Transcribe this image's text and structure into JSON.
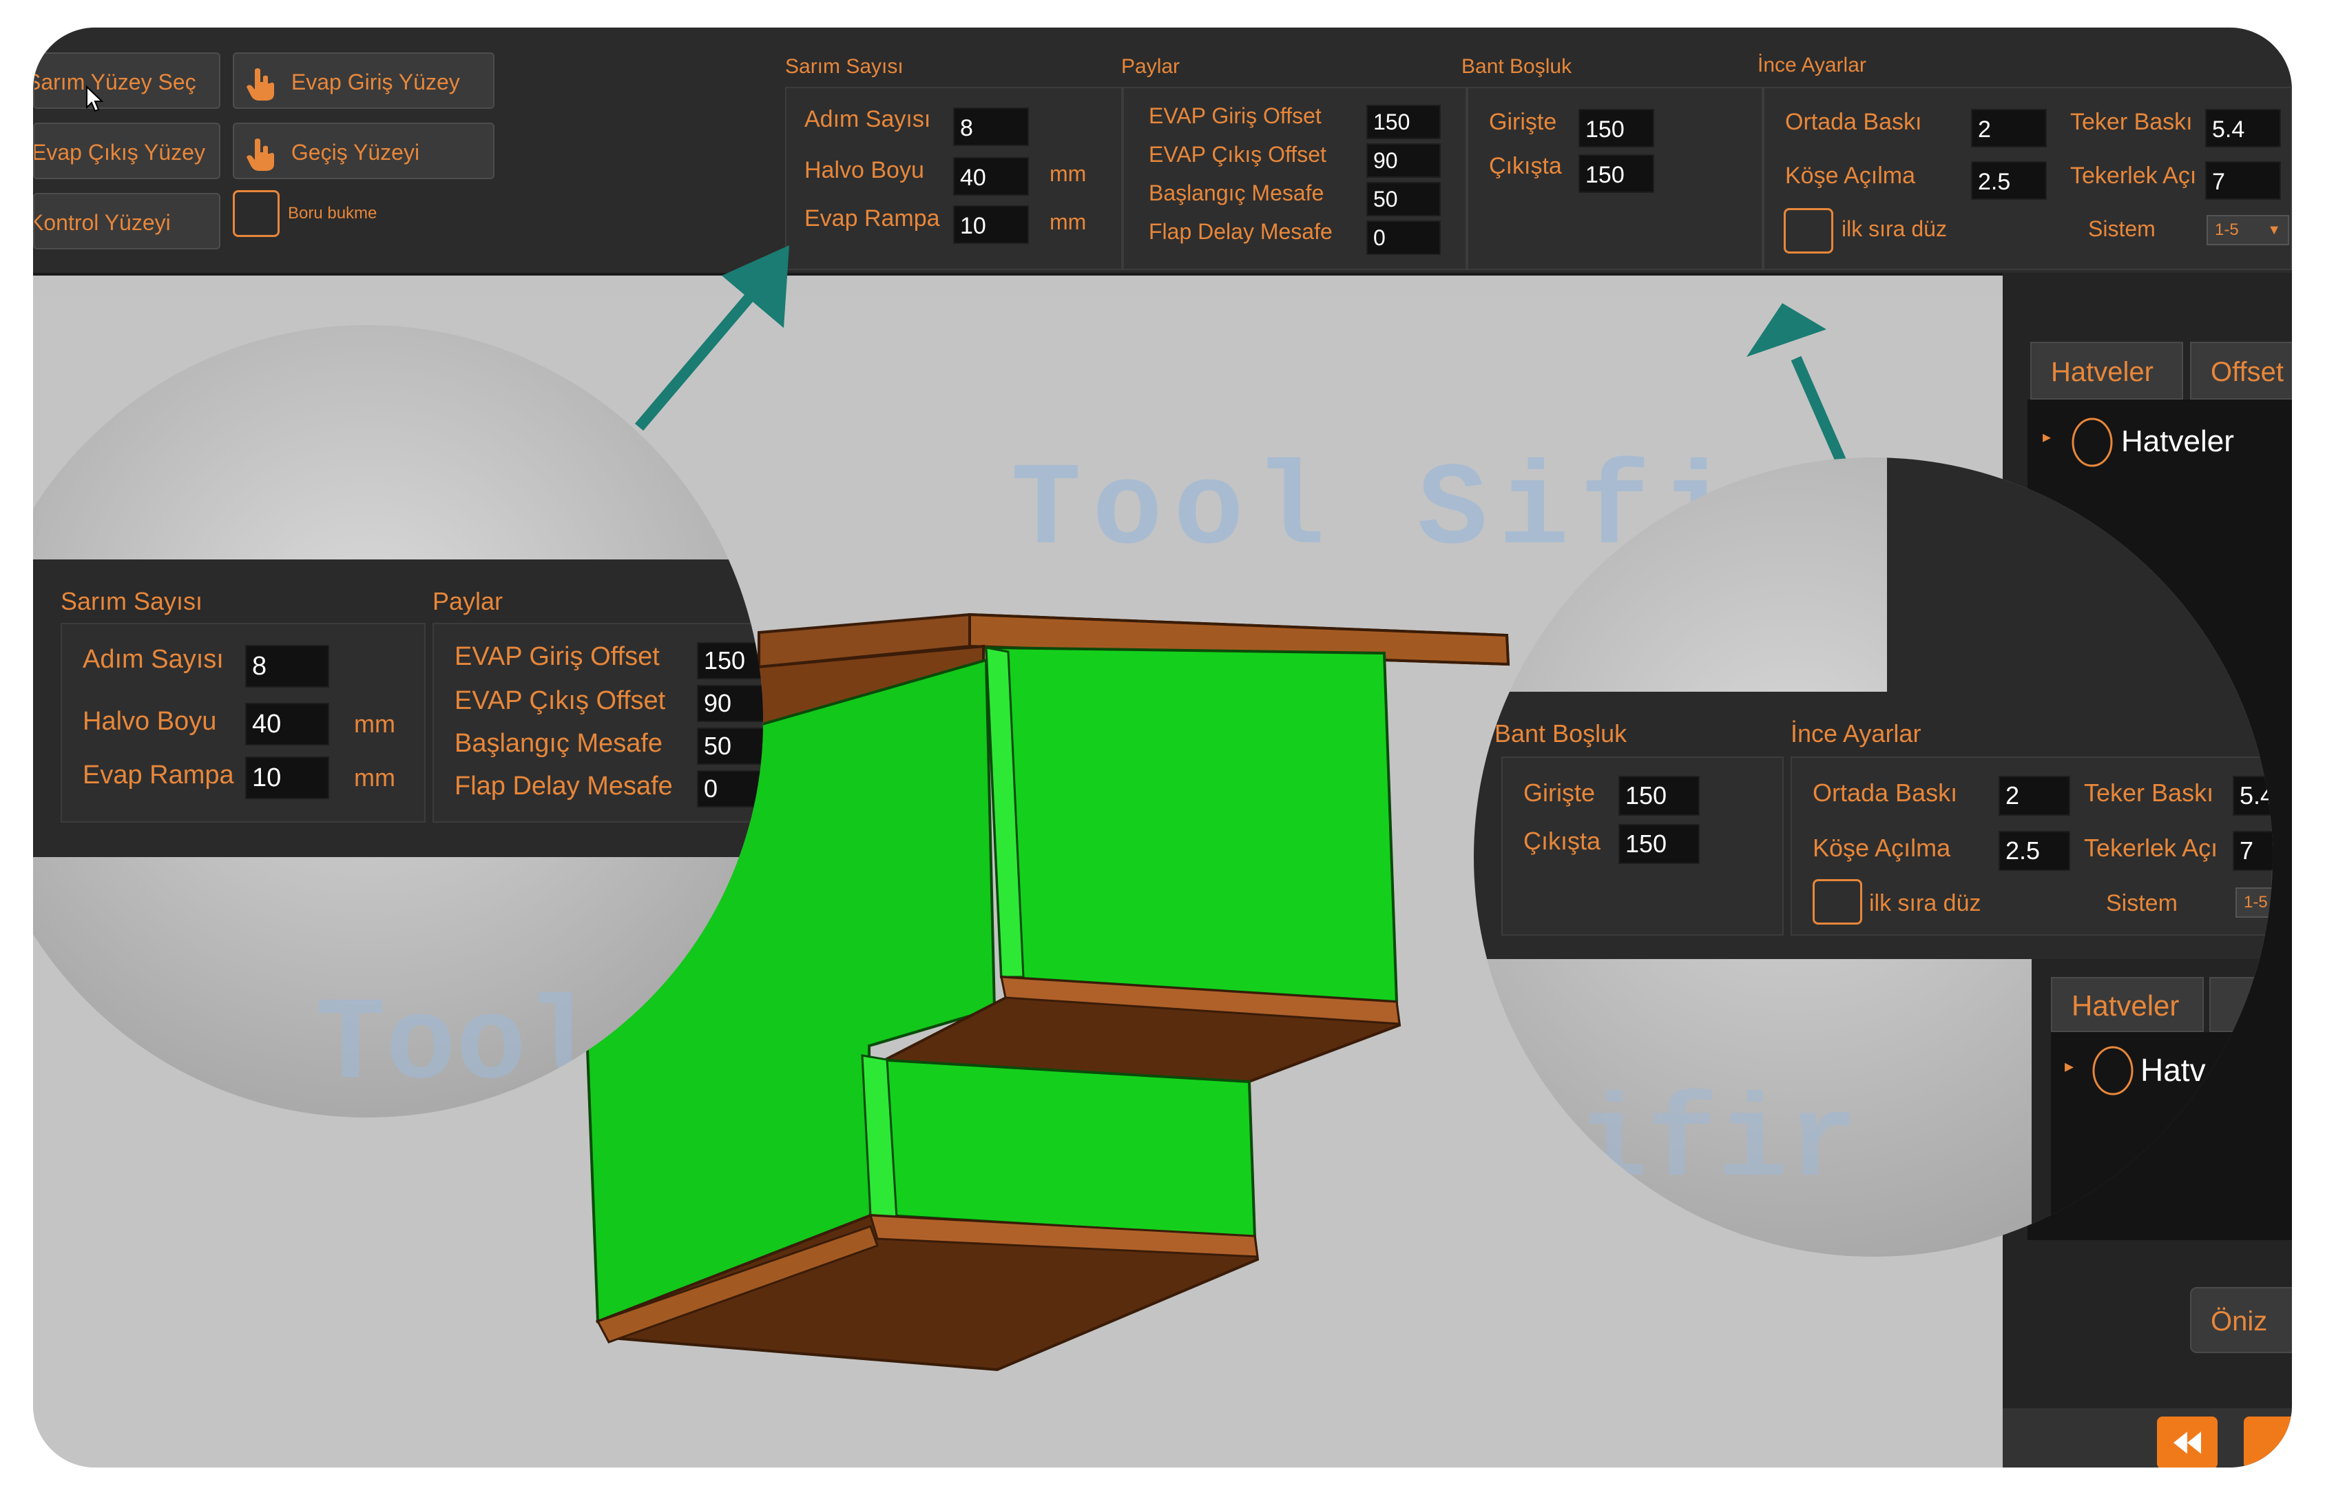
{
  "toolbar": {
    "buttons": {
      "sarim_yuzey_sec": "Sarım Yüzey Seç",
      "evap_giris_yuzey": "Evap Giriş Yüzey",
      "evap_cikis_yuzey": "Evap Çıkış Yüzey",
      "gecis_yuzeyi": "Geçiş Yüzeyi",
      "kontrol_yuzeyi": "Kontrol Yüzeyi"
    },
    "boru_bukme_label": "Boru bukme",
    "sarim_sayisi": {
      "title": "Sarım Sayısı",
      "adim_sayisi_label": "Adım Sayısı",
      "adim_sayisi_value": "8",
      "halvo_boyu_label": "Halvo Boyu",
      "halvo_boyu_value": "40",
      "halvo_boyu_unit": "mm",
      "evap_rampa_label": "Evap Rampa",
      "evap_rampa_value": "10",
      "evap_rampa_unit": "mm"
    },
    "paylar": {
      "title": "Paylar",
      "evap_giris_offset_label": "EVAP Giriş Offset",
      "evap_giris_offset_value": "150",
      "evap_cikis_offset_label": "EVAP Çıkış Offset",
      "evap_cikis_offset_value": "90",
      "baslangic_mesafe_label": "Başlangıç Mesafe",
      "baslangic_mesafe_value": "50",
      "flap_delay_mesafe_label": "Flap Delay Mesafe",
      "flap_delay_mesafe_value": "0"
    },
    "bant_bosluk": {
      "title": "Bant Boşluk",
      "giriste_label": "Girişte",
      "giriste_value": "150",
      "cikista_label": "Çıkışta",
      "cikista_value": "150"
    },
    "ince_ayarlar": {
      "title": "İnce Ayarlar",
      "ortada_baski_label": "Ortada Baskı",
      "ortada_baski_value": "2",
      "kose_acilma_label": "Köşe Açılma",
      "kose_acilma_value": "2.5",
      "ilk_sira_duz_label": "ilk sıra düz",
      "teker_baski_label": "Teker Baskı",
      "teker_baski_value": "5.4",
      "tekerlek_aci_label": "Tekerlek Açı",
      "tekerlek_aci_value": "7",
      "sistem_label": "Sistem",
      "sistem_value": "1-5"
    }
  },
  "viewport": {
    "watermark": "Tool Sifir"
  },
  "right_panel": {
    "tabs": [
      "Hatveler",
      "Offset"
    ],
    "tree_item": "Hatveler",
    "preview_button": "Öniz"
  },
  "lens_left": {
    "sarim_sayisi_title": "Sarım Sayısı",
    "adim_sayisi_label": "Adım Sayısı",
    "adim_sayisi_value": "8",
    "halvo_boyu_label": "Halvo Boyu",
    "halvo_boyu_value": "40",
    "halvo_boyu_unit": "mm",
    "evap_rampa_label": "Evap Rampa",
    "evap_rampa_value": "10",
    "evap_rampa_unit": "mm",
    "paylar_title": "Paylar",
    "evap_giris_offset_label": "EVAP Giriş Offset",
    "evap_giris_offset_value": "150",
    "evap_cikis_offset_label": "EVAP Çıkış Offset",
    "evap_cikis_offset_value": "90",
    "baslangic_mesafe_label": "Başlangıç Mesafe",
    "baslangic_mesafe_value": "50",
    "flap_delay_mesafe_label": "Flap Delay Mesafe",
    "flap_delay_mesafe_value": "0",
    "watermark": "Tool"
  },
  "lens_right": {
    "bant_bosluk_title": "Bant Boşluk",
    "giriste_label": "Girişte",
    "giriste_value": "150",
    "cikista_label": "Çıkışta",
    "cikista_value": "150",
    "ince_ayarlar_title": "İnce Ayarlar",
    "ortada_baski_label": "Ortada Baskı",
    "ortada_baski_value": "2",
    "kose_acilma_label": "Köşe Açılma",
    "kose_acilma_value": "2.5",
    "ilk_sira_duz_label": "ilk sıra düz",
    "teker_baski_label": "Teker Baskı",
    "teker_baski_value": "5.4",
    "tekerlek_aci_label": "Tekerlek Açı",
    "tekerlek_aci_value": "7",
    "sistem_label": "Sistem",
    "sistem_value": "1-5",
    "tab_label": "Hatveler",
    "tree_item": "Hatv",
    "watermark": "ifir"
  },
  "colors": {
    "accent": "#e8873a",
    "toolbar_bg": "#2b2b2b",
    "viewport_bg": "#c4c4c4",
    "part_green": "#12c81a",
    "part_copper": "#8a4a1c",
    "arrow": "#1a7c72"
  }
}
